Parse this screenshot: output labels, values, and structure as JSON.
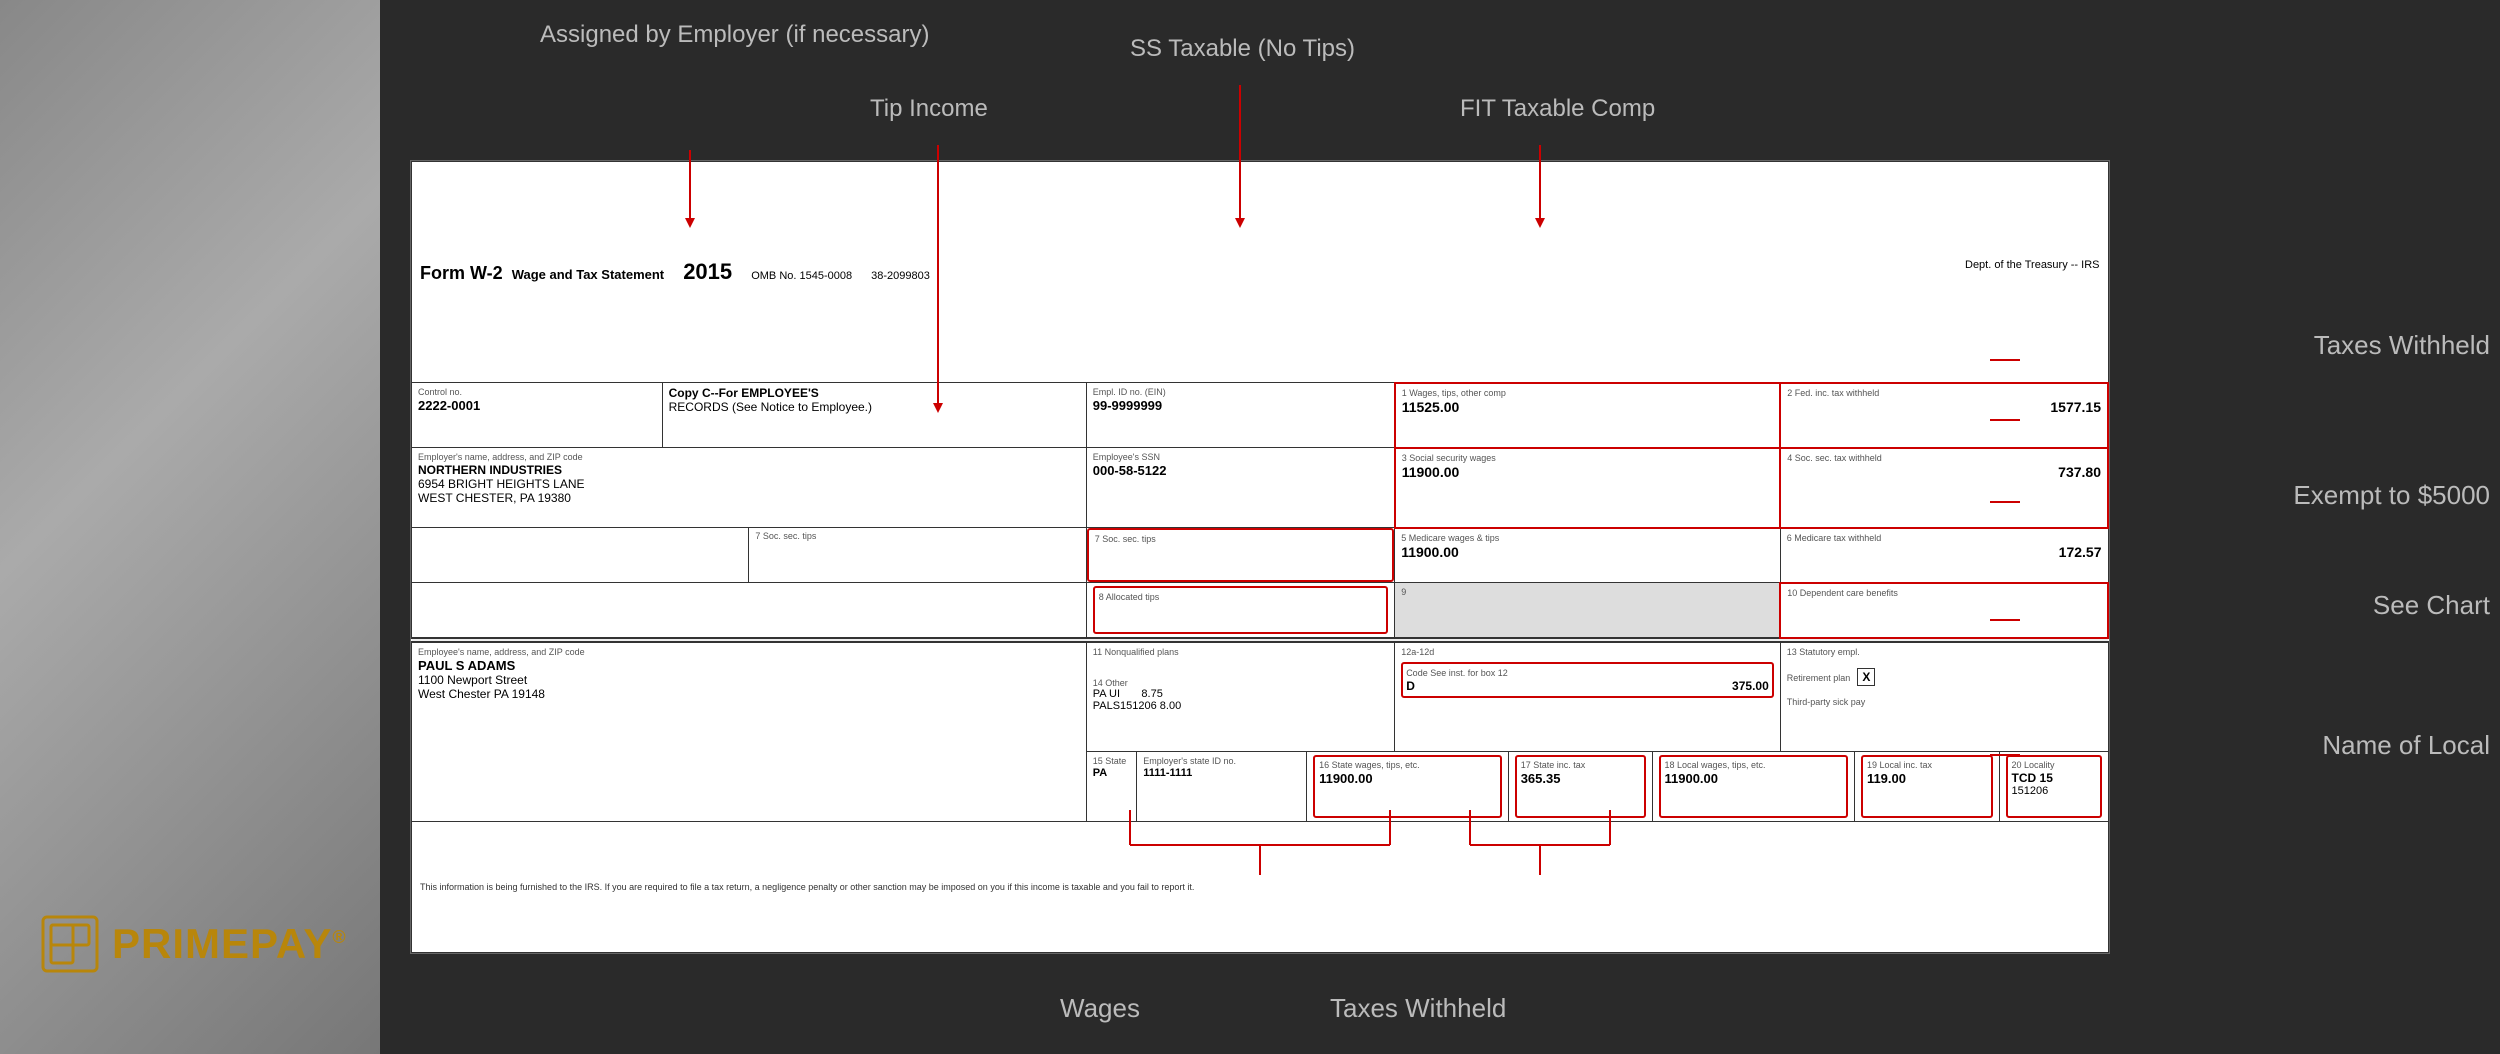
{
  "background": "#2a2a2a",
  "logo": {
    "icon_color": "#b8860b",
    "company_name": "PRIMEPAY",
    "trademark": "®"
  },
  "annotations": {
    "top": [
      {
        "id": "assigned-by-employer",
        "text": "Assigned by Employer\n(if necessary)",
        "position": "left"
      },
      {
        "id": "tip-income",
        "text": "Tip Income",
        "position": "center-left"
      },
      {
        "id": "ss-taxable",
        "text": "SS Taxable (No Tips)",
        "position": "center"
      },
      {
        "id": "fit-taxable",
        "text": "FIT Taxable Comp",
        "position": "center-right"
      }
    ],
    "right": [
      {
        "id": "taxes-withheld-top",
        "text": "Taxes Withheld"
      },
      {
        "id": "exempt-to-5000",
        "text": "Exempt to $5000"
      },
      {
        "id": "see-chart",
        "text": "See Chart"
      },
      {
        "id": "name-of-local",
        "text": "Name of Local"
      }
    ],
    "bottom": [
      {
        "id": "wages",
        "text": "Wages"
      },
      {
        "id": "taxes-withheld-bottom",
        "text": "Taxes Withheld"
      }
    ]
  },
  "form": {
    "title": "Form W-2",
    "subtitle": "Wage and Tax Statement",
    "year": "2015",
    "omb": "OMB No. 1545-0008",
    "ein_num": "38-2099803",
    "dept": "Dept. of the Treasury -- IRS",
    "copy_label": "Copy C--For EMPLOYEE'S",
    "copy_label2": "RECORDS (See Notice to Employee.)",
    "control_no_label": "Control no.",
    "control_no_value": "2222-0001",
    "employer_id_label": "Empl. ID no. (EIN)",
    "employer_id_value": "99-9999999",
    "box1_label": "1 Wages, tips, other comp",
    "box1_value": "11525.00",
    "box2_label": "2 Fed. inc. tax withheld",
    "box2_value": "1577.15",
    "employer_name_label": "Employer's name, address, and ZIP code",
    "employer_name": "NORTHERN INDUSTRIES",
    "employer_address1": "6954 BRIGHT HEIGHTS LANE",
    "employer_address2": "WEST CHESTER, PA 19380",
    "employee_ssn_label": "Employee's SSN",
    "employee_ssn_value": "000-58-5122",
    "box3_label": "3 Social security wages",
    "box3_value": "11900.00",
    "box4_label": "4 Soc. sec. tax withheld",
    "box4_value": "737.80",
    "box5_label": "5 Medicare wages & tips",
    "box5_value": "11900.00",
    "box6_label": "6 Medicare tax withheld",
    "box6_value": "172.57",
    "box7_label": "7 Soc. sec. tips",
    "box8_label": "8 Allocated tips",
    "box9_label": "9",
    "box10_label": "10 Dependent care benefits",
    "employee_name_label": "Employee's name, address, and ZIP code",
    "employee_name": "PAUL S ADAMS",
    "employee_address1": "1100 Newport Street",
    "employee_address2": "West Chester PA 19148",
    "box11_label": "11 Nonqualified plans",
    "box12a_label": "12a-12d",
    "box12_code": "Code  See inst. for box 12",
    "box12_letter": "D",
    "box12_value": "375.00",
    "box13_label": "13 Statutory empl.",
    "box14_label": "14 Other",
    "box14_items": [
      {
        "label": "PA UI",
        "value": "8.75"
      },
      {
        "label": "PALS151206",
        "value": "8.00"
      }
    ],
    "retirement_plan_label": "Retirement plan",
    "retirement_plan_value": "X",
    "third_party_label": "Third-party sick pay",
    "box15_state_label": "15 State",
    "box15_employer_id_label": "Employer's state ID no.",
    "box15_state_value": "PA",
    "box15_employer_id_value": "1111-1111",
    "box16_label": "16 State wages, tips, etc.",
    "box16_value": "11900.00",
    "box17_label": "17 State inc. tax",
    "box17_value": "365.35",
    "box18_label": "18 Local wages, tips, etc.",
    "box18_value": "11900.00",
    "box19_label": "19 Local inc. tax",
    "box19_value": "119.00",
    "box20_label": "20 Locality",
    "box20_value1": "TCD  15",
    "box20_value2": "151206",
    "footnote": "This information is being furnished to the IRS. If you are required to file a tax return, a negligence penalty or other sanction may be imposed on you if this income is taxable and you fail to report it."
  }
}
